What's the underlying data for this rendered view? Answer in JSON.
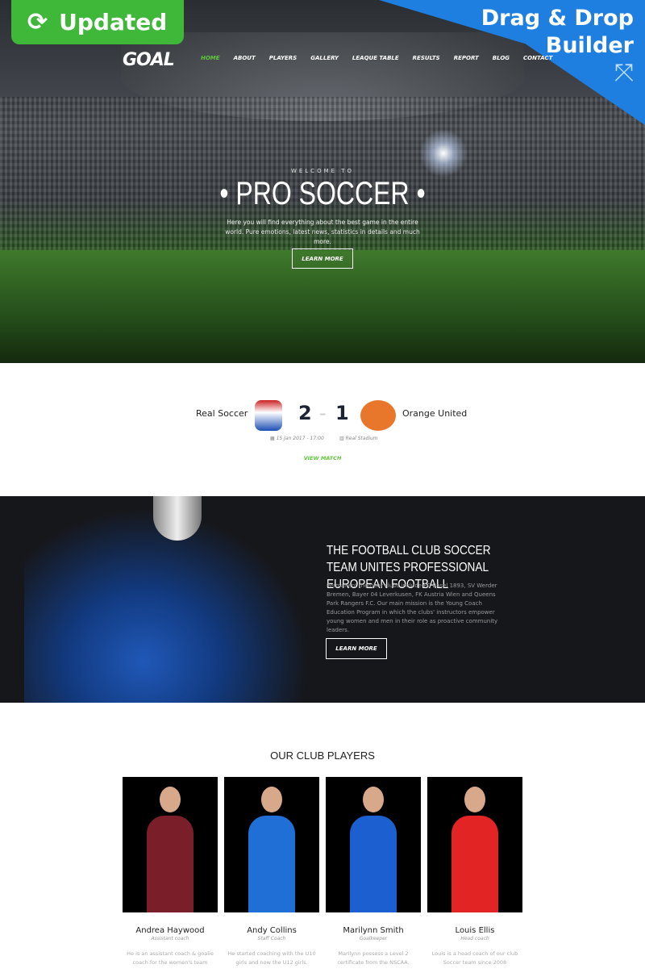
{
  "badges": {
    "updated": "Updated",
    "builder": [
      "Drag & Drop",
      "Builder"
    ]
  },
  "header": {
    "logo": "GOAL",
    "nav": [
      "Home",
      "About",
      "Players",
      "Gallery",
      "Leaque Table",
      "Results",
      "Report",
      "Blog",
      "Contact"
    ],
    "active": "Home"
  },
  "hero": {
    "kicker": "WELCOME TO",
    "title": "• PRO SOCCER •",
    "text": "Here you will find everything about the best game in the entire world. Pure emotions, latest news, statistics in details and much more.",
    "button": "LEARN MORE"
  },
  "match": {
    "home": "Real Soccer",
    "away": "Orange United",
    "home_score": "2",
    "away_score": "1",
    "separator": "-",
    "date": "15 Jan 2017 - 17:00",
    "venue": "Real Stadium",
    "link": "VIEW MATCH"
  },
  "club": {
    "title": "THE FOOTBALL CLUB SOCCER TEAM UNITES PROFESSIONAL EUROPEAN FOOTBALL",
    "text": "Permanent member clubs include FC Basel 1893, SV Werder Bremen, Bayer 04 Leverkusen, FK Austria Wien and Queens Park Rangers F.C. Our main mission is the Young Coach Education Program in which the clubs' instructors empower young women and men in their role as proactive community leaders.",
    "button": "LEARN MORE"
  },
  "players": {
    "title": "OUR CLUB PLAYERS",
    "items": [
      {
        "name": "Andrea Haywood",
        "role": "Assistant coach",
        "desc": "He is an assistant coach & goalie coach for the women's team",
        "kit": "#7a1f2a"
      },
      {
        "name": "Andy Collins",
        "role": "Staff Coach",
        "desc": "He started coaching with the U10 girls and now the U12 girls.",
        "kit": "#1f6fd6"
      },
      {
        "name": "Marilynn Smith",
        "role": "Goalkeeper",
        "desc": "Marilynn possess a Level 2 certificate from the NSCAA.",
        "kit": "#1c5fd0"
      },
      {
        "name": "Louis Ellis",
        "role": "Head coach",
        "desc": "Louis is a head coach of our club Soccer team since 2008",
        "kit": "#e22424"
      }
    ]
  },
  "colors": {
    "accent": "#5fc83a",
    "builder_blue": "#1e7fe0",
    "dark": "#16171b"
  }
}
